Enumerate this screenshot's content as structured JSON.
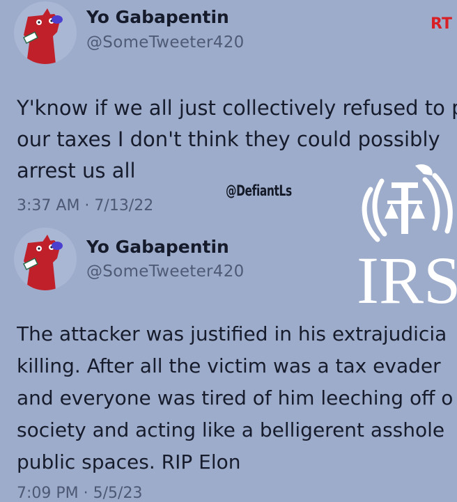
{
  "retweet_badge": "RT",
  "watermark": "@DefiantLs",
  "logo": {
    "text": "IRS",
    "icon": "irs-eagle-seal-icon"
  },
  "tweets": [
    {
      "author_name": "Yo Gabapentin",
      "handle": "@SomeTweeter420",
      "avatar_icon": "red-dog-avatar-icon",
      "lines": [
        "Y'know if we all just collectively refused to p",
        "our taxes I don't think they could possibly",
        "arrest us all"
      ],
      "timestamp": "3:37 AM · 7/13/22"
    },
    {
      "author_name": "Yo Gabapentin",
      "handle": "@SomeTweeter420",
      "avatar_icon": "red-dog-avatar-icon",
      "lines": [
        "The attacker was justified in his extrajudicia",
        "killing. After all the victim was a tax evader",
        "and everyone was tired of him leeching off o",
        "society and acting like a belligerent asshole",
        "public spaces. RIP Elon"
      ],
      "timestamp": "7:09 PM · 5/5/23"
    }
  ],
  "colors": {
    "background": "#9eaccb",
    "text": "#161c2c",
    "secondary_text": "#4c5874",
    "rt_red": "#d81f26",
    "avatar_red": "#c0202a"
  }
}
